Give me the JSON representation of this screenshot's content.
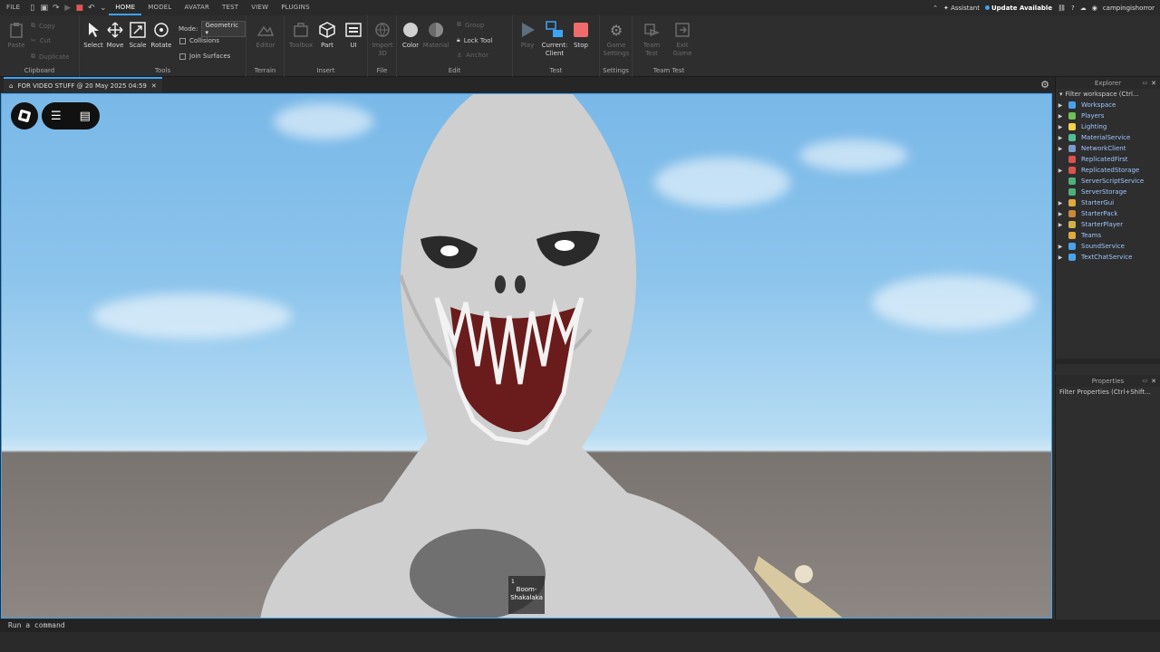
{
  "menubar": {
    "tabs": [
      {
        "label": "FILE",
        "active": false
      },
      {
        "label": "HOME",
        "active": true
      },
      {
        "label": "MODEL",
        "active": false
      },
      {
        "label": "AVATAR",
        "active": false
      },
      {
        "label": "TEST",
        "active": false
      },
      {
        "label": "VIEW",
        "active": false
      },
      {
        "label": "PLUGINS",
        "active": false
      }
    ],
    "assistant": "Assistant",
    "update": "Update Available",
    "username": "campingishorror"
  },
  "ribbon": {
    "clipboard": {
      "label": "Clipboard",
      "paste": "Paste",
      "copy": "Copy",
      "cut": "Cut",
      "duplicate": "Duplicate"
    },
    "tools": {
      "label": "Tools",
      "select": "Select",
      "move": "Move",
      "scale": "Scale",
      "rotate": "Rotate",
      "mode_label": "Mode:",
      "mode_value": "Geometric",
      "collisions": "Collisions",
      "join_surfaces": "Join Surfaces"
    },
    "terrain": {
      "label": "Terrain",
      "editor": "Editor"
    },
    "insert": {
      "label": "Insert",
      "toolbox": "Toolbox",
      "part": "Part",
      "ui": "UI"
    },
    "file": {
      "label": "File",
      "import3d": "Import 3D"
    },
    "edit": {
      "label": "Edit",
      "color": "Color",
      "material": "Material",
      "group": "Group",
      "lock_tool": "Lock Tool",
      "anchor": "Anchor"
    },
    "test": {
      "label": "Test",
      "play": "Play",
      "current_client": "Current: Client",
      "stop": "Stop"
    },
    "settings": {
      "label": "Settings",
      "game_settings": "Game Settings"
    },
    "team_test": {
      "label": "Team Test",
      "team_test": "Team Test",
      "exit_game": "Exit Game"
    }
  },
  "doc_tab": {
    "title": "FOR VIDEO STUFF @ 20 May 2025 04:59"
  },
  "viewport": {
    "hotbar_slot": "1",
    "hotbar_item": "Boom-Shakalaka"
  },
  "command_bar": {
    "placeholder": "Run a command"
  },
  "explorer": {
    "title": "Explorer",
    "filter": "Filter workspace (Ctrl...",
    "items": [
      {
        "label": "Workspace",
        "color": "#4aa3e8",
        "arrow": true
      },
      {
        "label": "Players",
        "color": "#6fbf5a",
        "arrow": true
      },
      {
        "label": "Lighting",
        "color": "#f2d14b",
        "arrow": true
      },
      {
        "label": "MaterialService",
        "color": "#4fbf9a",
        "arrow": true
      },
      {
        "label": "NetworkClient",
        "color": "#7a9ccc",
        "arrow": true
      },
      {
        "label": "ReplicatedFirst",
        "color": "#d9534f",
        "arrow": false
      },
      {
        "label": "ReplicatedStorage",
        "color": "#d9534f",
        "arrow": true
      },
      {
        "label": "ServerScriptService",
        "color": "#4fb07a",
        "arrow": false
      },
      {
        "label": "ServerStorage",
        "color": "#4fb07a",
        "arrow": false
      },
      {
        "label": "StarterGui",
        "color": "#e0a93c",
        "arrow": true
      },
      {
        "label": "StarterPack",
        "color": "#c8893a",
        "arrow": true
      },
      {
        "label": "StarterPlayer",
        "color": "#d0b24a",
        "arrow": true
      },
      {
        "label": "Teams",
        "color": "#e0a93c",
        "arrow": false
      },
      {
        "label": "SoundService",
        "color": "#4aa3e8",
        "arrow": true
      },
      {
        "label": "TextChatService",
        "color": "#4aa3e8",
        "arrow": true
      }
    ]
  },
  "properties": {
    "title": "Properties",
    "filter": "Filter Properties (Ctrl+Shift..."
  }
}
